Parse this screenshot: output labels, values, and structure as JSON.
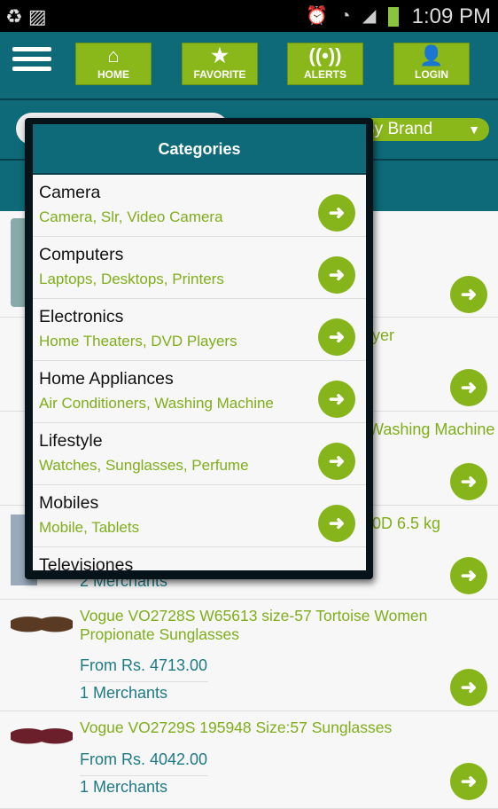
{
  "status_bar": {
    "time": "1:09 PM"
  },
  "nav": {
    "buttons": [
      {
        "label": "HOME",
        "icon": "home-icon"
      },
      {
        "label": "FAVORITE",
        "icon": "star-icon"
      },
      {
        "label": "ALERTS",
        "icon": "alerts-icon"
      },
      {
        "label": "LOGIN",
        "icon": "user-icon"
      }
    ]
  },
  "filter": {
    "brand_label": "By Brand"
  },
  "background_rows": [
    {
      "fragment": ""
    },
    {
      "fragment": "yer"
    },
    {
      "fragment": "Washing Machine"
    },
    {
      "fragment": "0D 6.5 kg",
      "merchants": "2 Merchants"
    },
    {
      "title": "Vogue VO2728S W65613 size-57 Tortoise Women Propionate Sunglasses",
      "price": "From Rs. 4713.00",
      "merchants": "1 Merchants"
    },
    {
      "title": "Vogue VO2729S 195948 Size:57 Sunglasses",
      "price": "From Rs. 4042.00",
      "merchants": "1 Merchants"
    }
  ],
  "popup": {
    "title": "Categories",
    "items": [
      {
        "name": "Camera",
        "sub": "Camera, Slr, Video Camera"
      },
      {
        "name": "Computers",
        "sub": "Laptops, Desktops, Printers"
      },
      {
        "name": "Electronics",
        "sub": "Home Theaters, DVD Players"
      },
      {
        "name": "Home Appliances",
        "sub": "Air Conditioners, Washing Machine"
      },
      {
        "name": "Lifestyle",
        "sub": "Watches, Sunglasses, Perfume"
      },
      {
        "name": "Mobiles",
        "sub": "Mobile, Tablets"
      },
      {
        "name": "Televisiones",
        "sub": ""
      }
    ]
  },
  "colors": {
    "teal": "#0e6a78",
    "green": "#8ab81a"
  }
}
